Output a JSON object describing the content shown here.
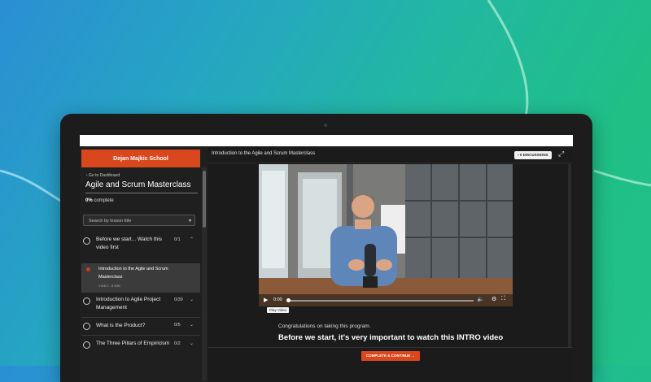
{
  "sidebar": {
    "school_name": "Dejan Majkic School",
    "back_link": "‹ Go to Dashboard",
    "course_title": "Agile and Scrum Masterclass",
    "progress_value": "0%",
    "progress_suffix": "complete",
    "search_placeholder": "Search by lesson title",
    "sections": [
      {
        "title": "Before we start... Watch this video first",
        "count": "0/1",
        "expanded": true
      },
      {
        "title": "Introduction to Agile Project Management",
        "count": "0/39",
        "expanded": false
      },
      {
        "title": "What is the Product?",
        "count": "0/5",
        "expanded": false
      },
      {
        "title": "The Three Pillars of Empiricism",
        "count": "0/2",
        "expanded": false
      }
    ],
    "active_lesson": {
      "title": "Introduction to the Agile and Scrum Masterclass",
      "meta": "VIDEO - 8 MIN"
    }
  },
  "main": {
    "lesson_title": "Introduction to the Agile and Scrum Masterclass",
    "discussions_label": "0 DISCUSSIONS",
    "video": {
      "time": "0:00",
      "tooltip": "Play Video",
      "progress": 0
    },
    "congrats_text": "Congratulations on taking this program.",
    "intro_heading": "Before we start, it's very important to watch this INTRO video",
    "complete_button": "COMPLETE & CONTINUE →"
  },
  "colors": {
    "accent": "#d9481d",
    "sidebar_bg": "#1f1f1f",
    "main_bg": "#1b1b1b"
  },
  "icons": [
    "chevron-left-icon",
    "caret-down-icon",
    "chevron-up-icon",
    "chevron-down-icon",
    "chat-icon",
    "expand-icon",
    "play-icon",
    "volume-icon",
    "gear-icon",
    "fullscreen-icon"
  ]
}
